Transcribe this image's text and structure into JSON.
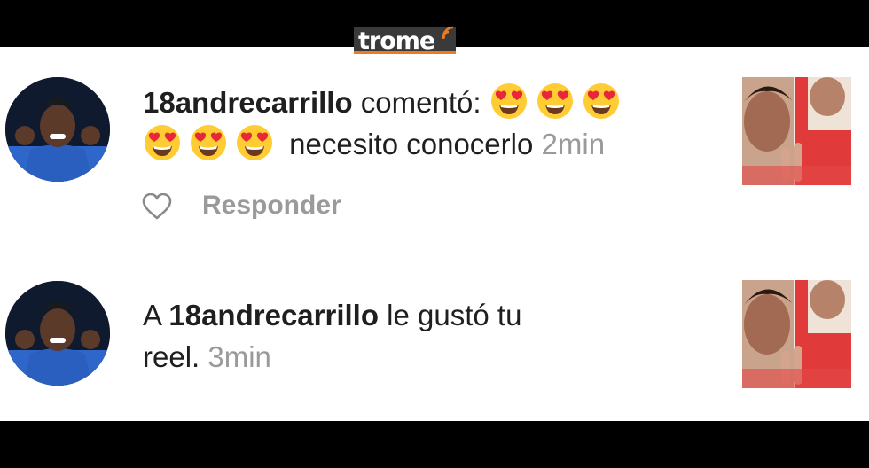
{
  "watermark": {
    "brand": "trome"
  },
  "notifications": [
    {
      "username": "18andrecarrillo",
      "action": "comentó:",
      "comment_text": "necesito conocerlo",
      "time": "2min",
      "reply_label": "Responder",
      "emojis": [
        "heart-eyes",
        "heart-eyes",
        "heart-eyes",
        "heart-eyes",
        "heart-eyes",
        "heart-eyes"
      ]
    },
    {
      "prefix": "A",
      "username": "18andrecarrillo",
      "action_line1": "le gustó tu",
      "action_line2": "reel.",
      "time": "3min"
    }
  ],
  "colors": {
    "text": "#1f1f1f",
    "muted": "#9a9a9a",
    "emoji_face": "#ffcc33",
    "emoji_heart": "#e8263c",
    "logo_accent": "#f07a1e"
  }
}
